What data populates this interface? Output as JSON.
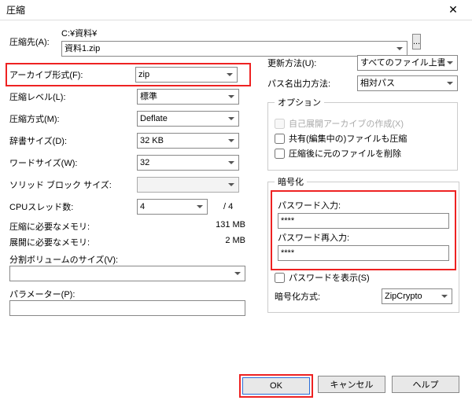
{
  "window": {
    "title": "圧縮"
  },
  "dest": {
    "label": "圧縮先(A):",
    "path": "C:¥資料¥",
    "file": "資料1.zip"
  },
  "left": {
    "archive_format": {
      "label": "アーカイブ形式(F):",
      "value": "zip"
    },
    "comp_level": {
      "label": "圧縮レベル(L):",
      "value": "標準"
    },
    "comp_method": {
      "label": "圧縮方式(M):",
      "value": "Deflate"
    },
    "dict_size": {
      "label": "辞書サイズ(D):",
      "value": "32 KB"
    },
    "word_size": {
      "label": "ワードサイズ(W):",
      "value": "32"
    },
    "solid_block": {
      "label": "ソリッド ブロック サイズ:"
    },
    "cpu_threads": {
      "label": "CPUスレッド数:",
      "value": "4",
      "total": "/ 4"
    },
    "mem_comp": {
      "label": "圧縮に必要なメモリ:",
      "value": "131 MB"
    },
    "mem_decomp": {
      "label": "展開に必要なメモリ:",
      "value": "2 MB"
    },
    "split_vol": {
      "label": "分割ボリュームのサイズ(V):"
    },
    "params": {
      "label": "パラメーター(P):"
    }
  },
  "right": {
    "update_mode": {
      "label": "更新方法(U):",
      "value": "すべてのファイル上書き"
    },
    "path_mode": {
      "label": "パス名出力方法:",
      "value": "相対パス"
    },
    "options_legend": "オプション",
    "sfx": {
      "label": "自己展開アーカイブの作成(X)"
    },
    "shared": {
      "label": "共有(編集中の)ファイルも圧縮"
    },
    "delete_after": {
      "label": "圧縮後に元のファイルを削除"
    },
    "enc_legend": "暗号化",
    "pwd": {
      "label": "パスワード入力:",
      "value": "****"
    },
    "pwd2": {
      "label": "パスワード再入力:",
      "value": "****"
    },
    "show_pwd": {
      "label": "パスワードを表示(S)"
    },
    "enc_method": {
      "label": "暗号化方式:",
      "value": "ZipCrypto"
    }
  },
  "footer": {
    "ok": "OK",
    "cancel": "キャンセル",
    "help": "ヘルプ"
  }
}
